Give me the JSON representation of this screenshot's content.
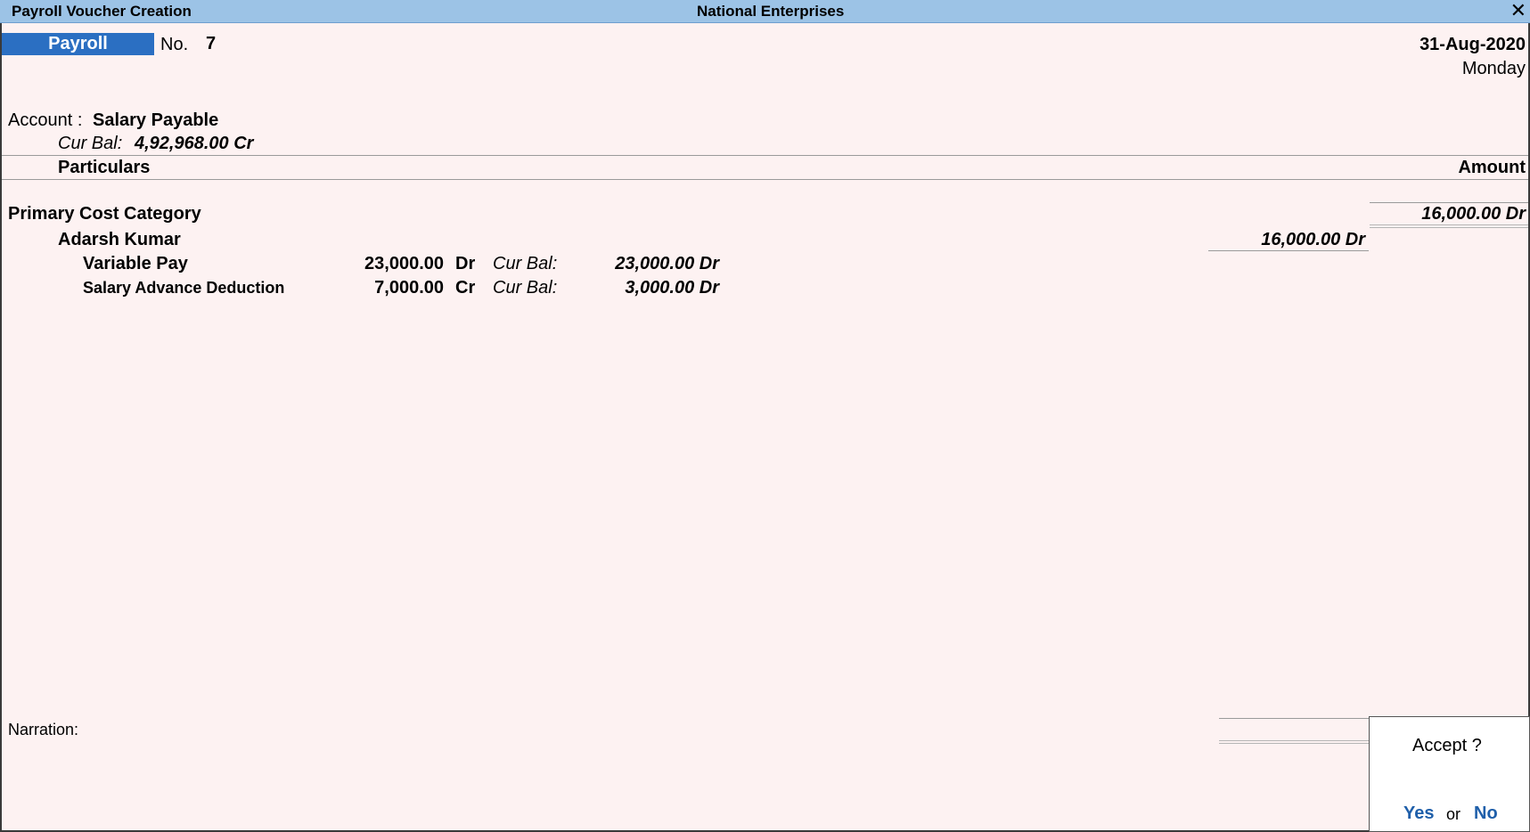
{
  "window": {
    "title": "Payroll Voucher Creation",
    "company": "National Enterprises",
    "close_glyph": "✕"
  },
  "voucher": {
    "type": "Payroll",
    "number_label": "No.",
    "number": "7",
    "date": "31-Aug-2020",
    "day": "Monday"
  },
  "account": {
    "label": "Account :",
    "name": "Salary Payable",
    "cur_bal_label": "Cur Bal:",
    "cur_bal_value": "4,92,968.00 Cr"
  },
  "table": {
    "col_particulars": "Particulars",
    "col_amount": "Amount"
  },
  "cost_category": {
    "name": "Primary Cost Category",
    "amount": "16,000.00 Dr"
  },
  "employee": {
    "name": "Adarsh Kumar",
    "amount": "16,000.00 Dr"
  },
  "pay_heads": [
    {
      "name": "Variable Pay",
      "amount": "23,000.00",
      "drcr": "Dr",
      "cur_bal_label": "Cur Bal:",
      "cur_bal": "23,000.00 Dr"
    },
    {
      "name": "Salary Advance Deduction",
      "amount": "7,000.00",
      "drcr": "Cr",
      "cur_bal_label": "Cur Bal:",
      "cur_bal": "3,000.00 Dr"
    }
  ],
  "narration": {
    "label": "Narration:",
    "value": ""
  },
  "accept_dialog": {
    "question": "Accept ?",
    "yes": "Yes",
    "or": "or",
    "no": "No"
  },
  "colors": {
    "titlebar": "#9cc3e6",
    "voucher_type_bg": "#2b6fc2",
    "background": "#fdf2f2",
    "link": "#1f5faa"
  }
}
